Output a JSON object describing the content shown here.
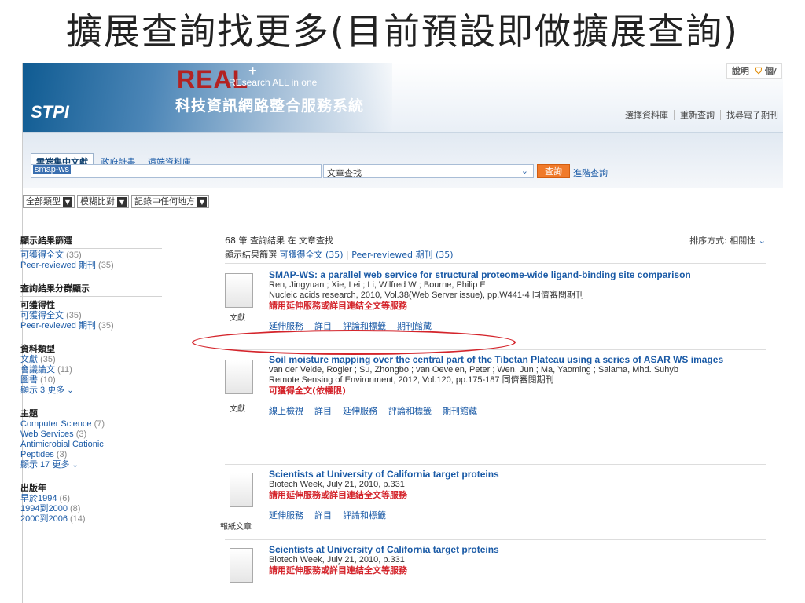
{
  "slide_title": "擴展查詢找更多(目前預設即做擴展查詢)",
  "colors": {
    "accent_red": "#d4242b",
    "link_blue": "#1a5aa6",
    "search_button": "#f07a2a"
  },
  "header": {
    "stpi_logo": "STPI",
    "real_logo": "REAL",
    "real_plus": "+",
    "real_tagline": "REsearch ALL in one",
    "system_name": "科技資訊網路整合服務系統",
    "tools": {
      "help": "說明",
      "cart": "個/"
    },
    "links": [
      "選擇資料庫",
      "重新查詢",
      "找尋電子期刊"
    ]
  },
  "search": {
    "tabs": [
      "雲端集中文獻",
      "政府計畫",
      "遠端資料庫"
    ],
    "query": "smap-ws",
    "scope": "文章查找",
    "submit_label": "查詢",
    "advanced_label": "進階查詢"
  },
  "filters": {
    "type": "全部類型",
    "match": "模糊比對",
    "field": "記錄中任何地方"
  },
  "sidebar": {
    "show_filter_title": "顯示結果篩選",
    "show_filter_items": [
      {
        "label": "可獲得全文",
        "count": "(35)"
      },
      {
        "label": "Peer-reviewed 期刊",
        "count": "(35)"
      }
    ],
    "group_title": "查詢結果分群顯示",
    "availability_title": "可獲得性",
    "availability_items": [
      {
        "label": "可獲得全文",
        "count": "(35)"
      },
      {
        "label": "Peer-reviewed 期刊",
        "count": "(35)"
      }
    ],
    "type_title": "資料類型",
    "type_items": [
      {
        "label": "文獻",
        "count": "(35)"
      },
      {
        "label": "會議論文",
        "count": "(11)"
      },
      {
        "label": "圖書",
        "count": "(10)"
      }
    ],
    "type_more": "顯示 3 更多",
    "topic_title": "主題",
    "topic_items": [
      {
        "label": "Computer Science",
        "count": "(7)"
      },
      {
        "label": "Web Services",
        "count": "(3)"
      },
      {
        "label": "Antimicrobial Cationic Peptides",
        "count": "(3)"
      }
    ],
    "topic_more": "顯示 17 更多",
    "year_title": "出版年",
    "year_items": [
      {
        "label": "早於1994",
        "count": "(6)"
      },
      {
        "label": "1994到2000",
        "count": "(8)"
      },
      {
        "label": "2000到2006",
        "count": "(14)"
      }
    ]
  },
  "results": {
    "count_text": "68 筆 查詢結果 在 文章查找",
    "sort_text": "排序方式: 相關性",
    "filter_prefix": "顯示結果篩選",
    "filter_chip_1": "可獲得全文 (35)",
    "filter_chip_2": "Peer-reviewed 期刊 (35)",
    "items": [
      {
        "type_label": "文獻",
        "title": "SMAP-WS: a parallel web service for structural proteome-wide ligand-binding site comparison",
        "authors": "Ren, Jingyuan ; Xie, Lei ; Li, Wilfred W ; Bourne, Philip E",
        "source": "Nucleic acids research, 2010, Vol.38(Web Server issue), pp.W441-4 同儕審閱期刊",
        "note": "請用延伸服務或詳目連結全文等服務",
        "actions": [
          "延伸服務",
          "詳目",
          "評論和標籤",
          "期刊館藏"
        ]
      },
      {
        "type_label": "文獻",
        "title": "Soil moisture mapping over the central part of the Tibetan Plateau using a series of ASAR WS images",
        "authors": "van der Velde, Rogier ; Su, Zhongbo ; van Oevelen, Peter ; Wen, Jun ; Ma, Yaoming ; Salama, Mhd. Suhyb",
        "source": "Remote Sensing of Environment, 2012, Vol.120, pp.175-187 同儕審閱期刊",
        "note": "可獲得全文(依權限)",
        "actions": [
          "線上檢視",
          "詳目",
          "延伸服務",
          "評論和標籤",
          "期刊館藏"
        ]
      },
      {
        "type_label": "報紙文章",
        "title": "Scientists at University of California target proteins",
        "authors": "",
        "source": "Biotech Week, July 21, 2010, p.331",
        "note": "請用延伸服務或詳目連結全文等服務",
        "actions": [
          "延伸服務",
          "詳目",
          "評論和標籤"
        ]
      },
      {
        "type_label": "",
        "title": "Scientists at University of California target proteins",
        "authors": "",
        "source": "Biotech Week, July 21, 2010, p.331",
        "note": "請用延伸服務或詳目連結全文等服務",
        "actions": []
      }
    ]
  }
}
